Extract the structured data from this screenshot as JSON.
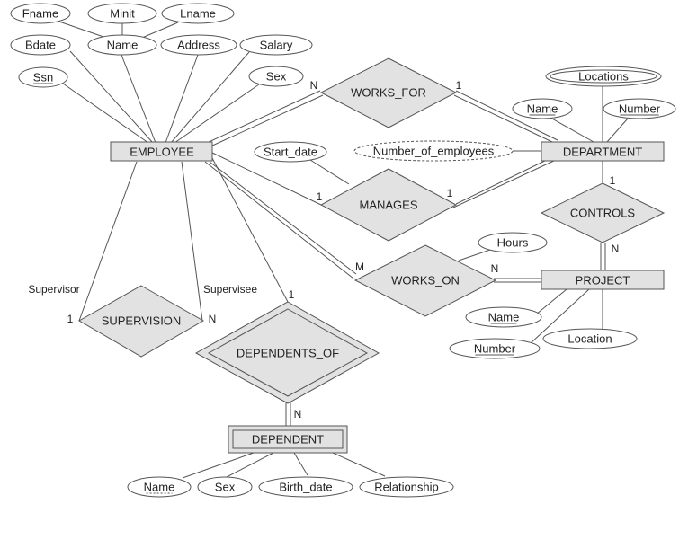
{
  "entities": {
    "employee": "EMPLOYEE",
    "department": "DEPARTMENT",
    "project": "PROJECT",
    "dependent": "DEPENDENT"
  },
  "relationships": {
    "works_for": "WORKS_FOR",
    "manages": "MANAGES",
    "controls": "CONTROLS",
    "works_on": "WORKS_ON",
    "supervision": "SUPERVISION",
    "dependents_of": "DEPENDENTS_OF"
  },
  "attributes": {
    "fname": "Fname",
    "minit": "Minit",
    "lname": "Lname",
    "bdate": "Bdate",
    "name": "Name",
    "address": "Address",
    "salary": "Salary",
    "ssn": "Ssn",
    "sex": "Sex",
    "start_date": "Start_date",
    "number_of_employees": "Number_of_employees",
    "locations": "Locations",
    "dept_name": "Name",
    "dept_number": "Number",
    "hours": "Hours",
    "proj_name": "Name",
    "proj_number": "Number",
    "proj_location": "Location",
    "dep_name": "Name",
    "dep_sex": "Sex",
    "dep_birth_date": "Birth_date",
    "dep_relationship": "Relationship"
  },
  "cardinalities": {
    "works_for_emp": "N",
    "works_for_dept": "1",
    "manages_emp": "1",
    "manages_dept": "1",
    "controls_dept": "1",
    "controls_proj": "N",
    "works_on_emp": "M",
    "works_on_proj": "N",
    "supervision_supervisor": "1",
    "supervision_supervisee": "N",
    "dependents_of_emp": "1",
    "dependents_of_dep": "N"
  },
  "roles": {
    "supervisor": "Supervisor",
    "supervisee": "Supervisee"
  },
  "colors": {
    "entity_fill": "#e2e2e2",
    "line": "#555555"
  }
}
